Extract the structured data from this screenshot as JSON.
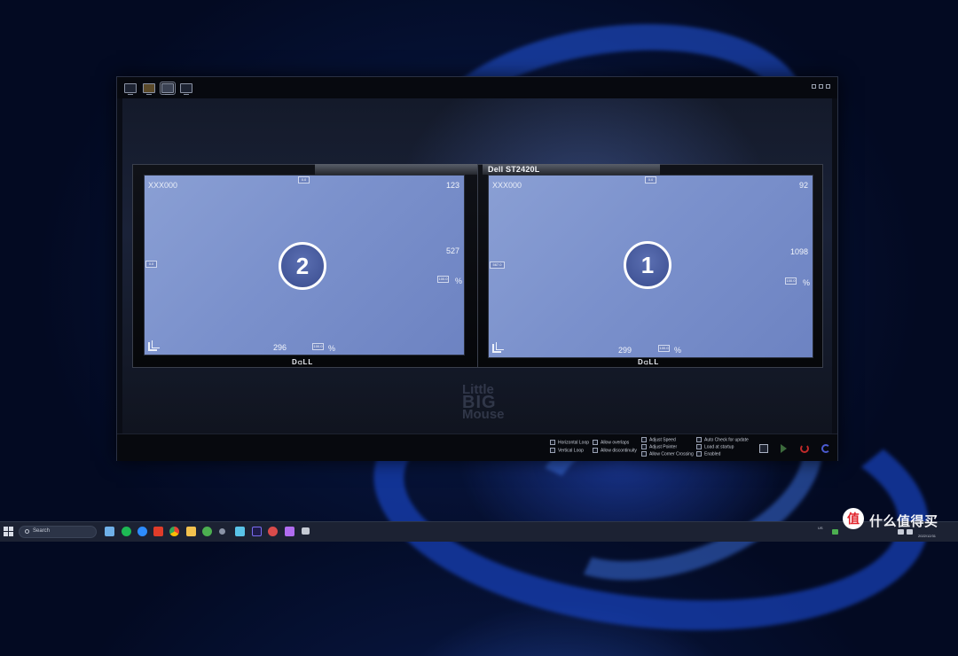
{
  "window": {
    "toolbar_icons": [
      "monitor-icon",
      "monitor-color-icon",
      "monitor-link-icon",
      "monitor-dual-icon"
    ],
    "selected_tool": "monitor-link-icon"
  },
  "monitors": [
    {
      "id": "2",
      "model": "",
      "brand": "D⫏LL",
      "name": "XXX000",
      "top_value": "123",
      "right_value": "527",
      "bottom_value": "296",
      "top_box": "0.0",
      "left_box": "0.0",
      "right_box": "100.0",
      "bottom_box": "100.0",
      "pct": "%"
    },
    {
      "id": "1",
      "model": "Dell ST2420L",
      "brand": "D⫏LL",
      "name": "XXX000",
      "top_value": "92",
      "right_value": "1098",
      "bottom_value": "299",
      "top_box": "0.0",
      "left_box": "567.0",
      "right_box": "100.0",
      "bottom_box": "100.0",
      "pct": "%"
    }
  ],
  "watermark": {
    "line1": "Little",
    "line2": "BIG",
    "line3": "Mouse"
  },
  "options": {
    "horizontal_loop": "Horizontal Loop",
    "vertical_loop": "Vertical Loop",
    "allow_overlaps": "Allow overlaps",
    "allow_discontinuity": "Allow discontinuity",
    "adjust_speed": "Adjust Speed",
    "adjust_pointer": "Adjust Pointer",
    "allow_corner_crossing": "Allow Corner Crossing",
    "auto_check_update": "Auto Check for update",
    "load_at_startup": "Load at startup",
    "enabled": "Enabled"
  },
  "taskbar": {
    "search_placeholder": "Search",
    "clock_time": "",
    "clock_date": "2022/12/31",
    "lang": "US"
  },
  "corner_logo": {
    "glyph": "值",
    "text": "什么值得买"
  },
  "colors": {
    "screen": "#7b91cc",
    "accent_power": "#c02a2a",
    "accent_refresh": "#4b5bd0",
    "accent_play": "#3c6a3c"
  }
}
